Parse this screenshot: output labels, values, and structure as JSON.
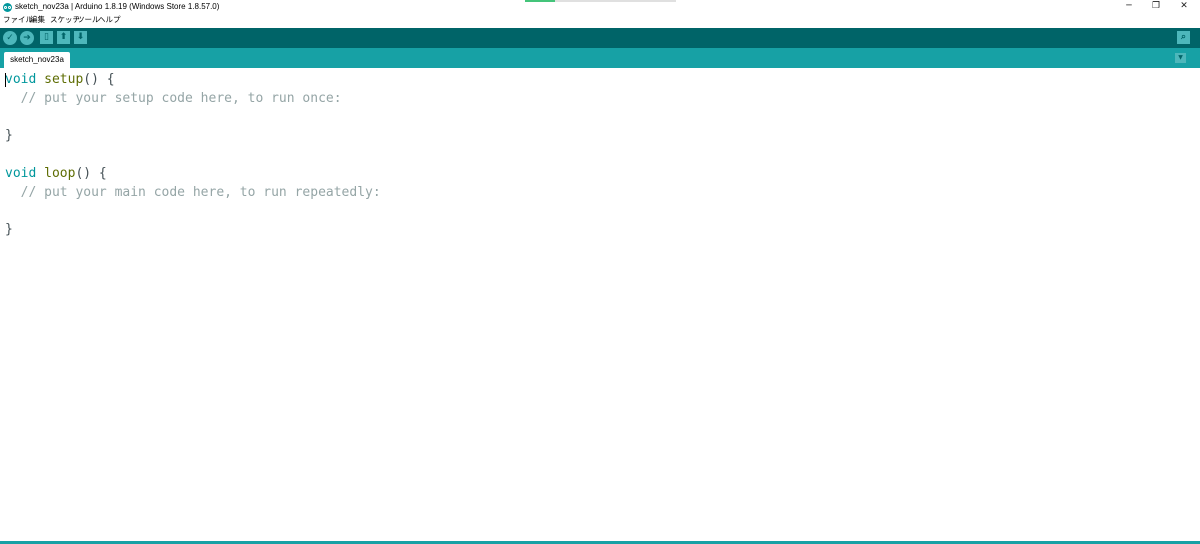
{
  "window": {
    "title": "sketch_nov23a | Arduino 1.8.19 (Windows Store 1.8.57.0)",
    "minimize_glyph": "─",
    "restore_glyph": "❐",
    "close_glyph": "✕",
    "progress": 0.2
  },
  "menu": {
    "items": [
      "ファイル",
      "編集",
      "スケッチ",
      "ツール",
      "ヘルプ"
    ]
  },
  "toolbar": {
    "verify_glyph": "✓",
    "upload_glyph": "➔",
    "new_glyph": "▯",
    "open_glyph": "⬆",
    "save_glyph": "⬇",
    "serial_glyph": "⌕"
  },
  "tabs": {
    "items": [
      "sketch_nov23a"
    ],
    "menu_glyph": "▼"
  },
  "editor": {
    "lines": [
      [
        {
          "t": "void",
          "c": "kw-type"
        },
        {
          "t": " ",
          "c": ""
        },
        {
          "t": "setup",
          "c": "kw-func"
        },
        {
          "t": "() {",
          "c": ""
        }
      ],
      [
        {
          "t": "  // put your setup code here, to run once:",
          "c": "cmt"
        }
      ],
      [],
      [
        {
          "t": "}",
          "c": ""
        }
      ],
      [],
      [
        {
          "t": "void",
          "c": "kw-type"
        },
        {
          "t": " ",
          "c": ""
        },
        {
          "t": "loop",
          "c": "kw-func"
        },
        {
          "t": "() {",
          "c": ""
        }
      ],
      [
        {
          "t": "  // put your main code here, to run repeatedly:",
          "c": "cmt"
        }
      ],
      [],
      [
        {
          "t": "}",
          "c": ""
        }
      ]
    ]
  },
  "colors": {
    "toolbar": "#006468",
    "tabbar": "#17a1a5",
    "button": "#4db7bb",
    "keyword_type": "#00979c",
    "keyword_function": "#5e6d03",
    "comment": "#95a5a6"
  }
}
